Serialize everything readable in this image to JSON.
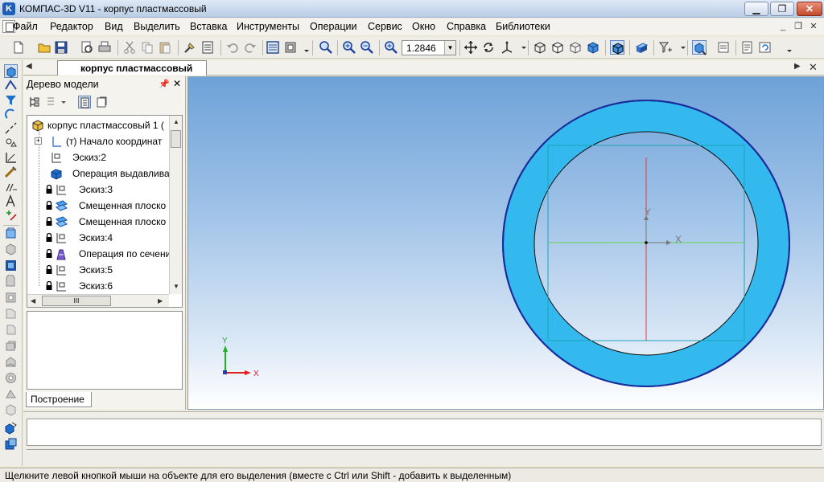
{
  "window": {
    "title": "КОМПАС-3D V11 - корпус пластмассовый",
    "app_icon_letter": "K",
    "minimize_label": "▁",
    "restore_label": "❐",
    "close_label": "✕"
  },
  "menu": {
    "items": [
      {
        "label": "Файл"
      },
      {
        "label": "Редактор"
      },
      {
        "label": "Вид"
      },
      {
        "label": "Выделить"
      },
      {
        "label": "Вставка"
      },
      {
        "label": "Инструменты"
      },
      {
        "label": "Операции"
      },
      {
        "label": "Сервис"
      },
      {
        "label": "Окно"
      },
      {
        "label": "Справка"
      },
      {
        "label": "Библиотеки"
      }
    ],
    "doc_minimize": "_",
    "doc_restore": "❐",
    "doc_close": "✕"
  },
  "toolbar": {
    "zoom_value": "1.2846",
    "zoom_arrow": "▼"
  },
  "tabs": {
    "nav_left": "◀",
    "doc_tab_label": "корпус пластмассовый",
    "nav_right": "▶",
    "close": "✕"
  },
  "tree_panel": {
    "title": "Дерево модели",
    "pin": "📌",
    "close": "✕",
    "items": [
      {
        "label": "корпус пластмассовый 1 (",
        "icon": "part-icon"
      },
      {
        "label": "(т) Начало координат",
        "icon": "origin-icon"
      },
      {
        "label": "Эскиз:2",
        "icon": "sketch-icon"
      },
      {
        "label": "Операция выдавлива",
        "icon": "extrude-icon"
      },
      {
        "label": "Эскиз:3",
        "icon": "sketch-icon"
      },
      {
        "label": "Смещенная плоско",
        "icon": "plane-icon"
      },
      {
        "label": "Смещенная плоско",
        "icon": "plane-icon"
      },
      {
        "label": "Эскиз:4",
        "icon": "sketch-icon"
      },
      {
        "label": "Операция по сечени",
        "icon": "loft-icon"
      },
      {
        "label": "Эскиз:5",
        "icon": "sketch-icon"
      },
      {
        "label": "Эскиз:6",
        "icon": "sketch-icon"
      }
    ],
    "hscroll_grip": "III",
    "bottom_tab": "Построение"
  },
  "viewport": {
    "axis_x_label": "X",
    "axis_y_label": "Y",
    "local_axis_x_label": "X",
    "local_axis_y_label": "Y"
  },
  "status": {
    "text": "Щелкните левой кнопкой мыши на объекте для его выделения (вместе с Ctrl или Shift - добавить к выделенным)"
  },
  "colors": {
    "ring_fill": "#33b9ee",
    "ring_stroke": "#1a2c9a",
    "viewport_top": "#6ea2d8",
    "axis_x": "#e02020",
    "axis_y": "#20b020"
  }
}
